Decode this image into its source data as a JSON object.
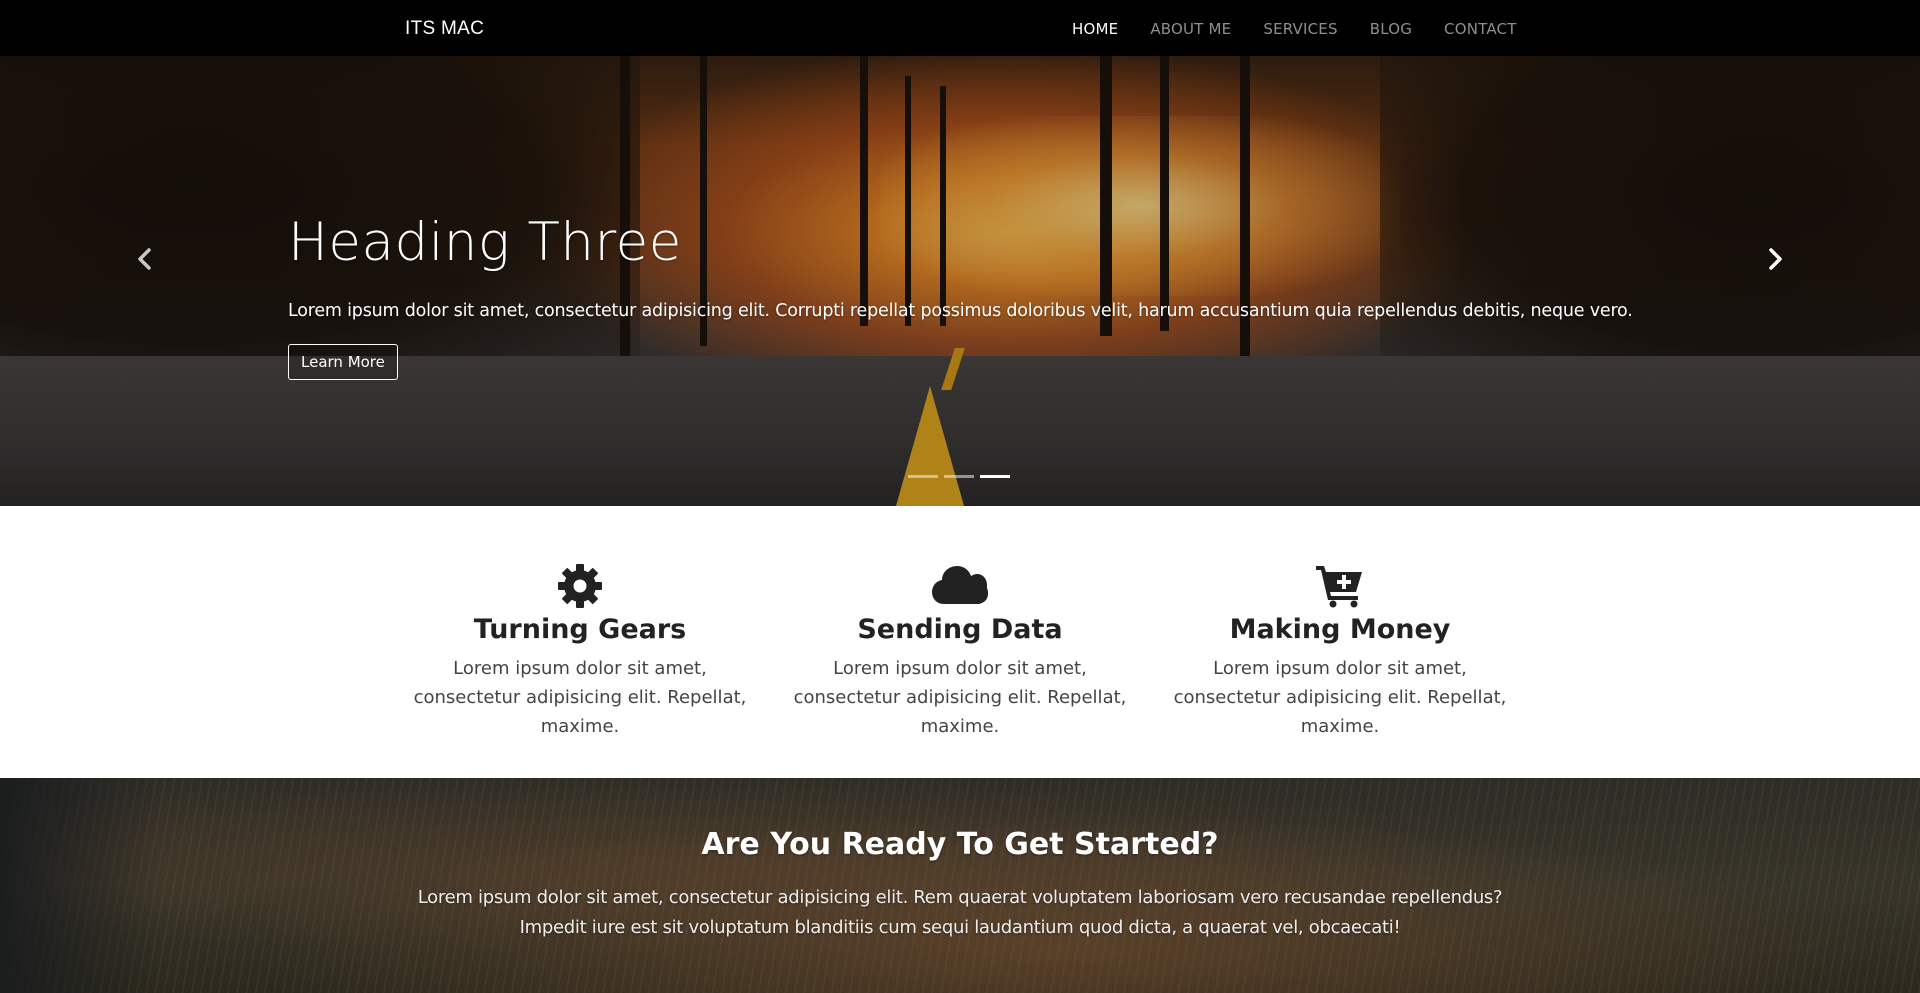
{
  "navbar": {
    "brand": "ITS MAC",
    "links": [
      {
        "label": "HOME",
        "active": true
      },
      {
        "label": "ABOUT ME",
        "active": false
      },
      {
        "label": "SERVICES",
        "active": false
      },
      {
        "label": "BLOG",
        "active": false
      },
      {
        "label": "CONTACT",
        "active": false
      }
    ]
  },
  "hero": {
    "heading": "Heading Three",
    "text": "Lorem ipsum dolor sit amet, consectetur adipisicing elit. Corrupti repellat possimus doloribus velit, harum accusantium quia repellendus debitis, neque vero.",
    "button_label": "Learn More",
    "prev_icon": "chevron-left-icon",
    "next_icon": "chevron-right-icon",
    "slide_count": 3,
    "active_slide": 3
  },
  "features": [
    {
      "icon": "gear-icon",
      "title": "Turning Gears",
      "text": "Lorem ipsum dolor sit amet, consectetur adipisicing elit. Repellat, maxime."
    },
    {
      "icon": "cloud-icon",
      "title": "Sending Data",
      "text": "Lorem ipsum dolor sit amet, consectetur adipisicing elit. Repellat, maxime."
    },
    {
      "icon": "cart-plus-icon",
      "title": "Making Money",
      "text": "Lorem ipsum dolor sit amet, consectetur adipisicing elit. Repellat, maxime."
    }
  ],
  "cta": {
    "title": "Are You Ready To Get Started?",
    "text": "Lorem ipsum dolor sit amet, consectetur adipisicing elit. Rem quaerat voluptatem laboriosam vero recusandae repellendus? Impedit iure est sit voluptatum blanditiis cum sequi laudantium quod dicta, a quaerat vel, obcaecati!"
  },
  "colors": {
    "navbar_bg": "#000000",
    "nav_active": "#ffffff",
    "nav_inactive": "#8f8f8f",
    "icon_dark": "#222222"
  }
}
